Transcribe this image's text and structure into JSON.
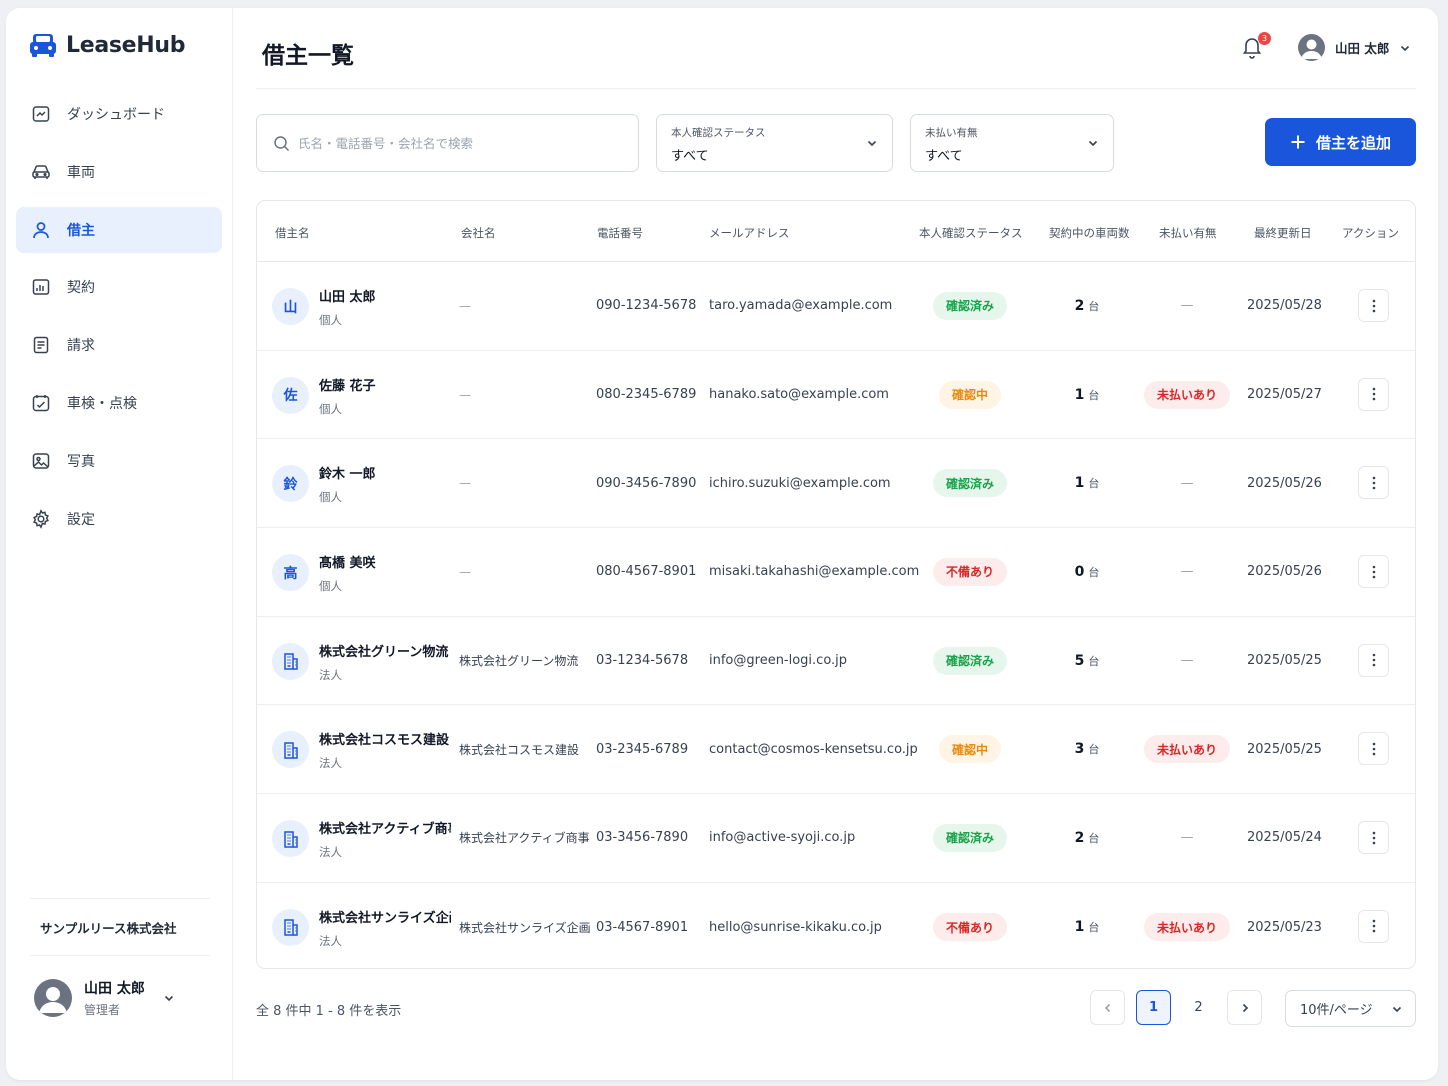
{
  "app": {
    "name": "LeaseHub"
  },
  "sidebar": {
    "items": [
      {
        "label": "ダッシュボード",
        "icon": "dashboard-icon"
      },
      {
        "label": "車両",
        "icon": "car-icon"
      },
      {
        "label": "借主",
        "icon": "user-icon",
        "active": true
      },
      {
        "label": "契約",
        "icon": "contract-icon"
      },
      {
        "label": "請求",
        "icon": "invoice-icon"
      },
      {
        "label": "車検・点検",
        "icon": "inspection-icon"
      },
      {
        "label": "写真",
        "icon": "photo-icon"
      },
      {
        "label": "設定",
        "icon": "gear-icon"
      }
    ],
    "company": "サンプルリース株式会社",
    "user": {
      "name": "山田 太郎",
      "role": "管理者"
    }
  },
  "header": {
    "title": "借主一覧",
    "notification_count": "3",
    "user_name": "山田 太郎"
  },
  "toolbar": {
    "search_placeholder": "氏名・電話番号・会社名で検索",
    "filter_status": {
      "label": "本人確認ステータス",
      "value": "すべて"
    },
    "filter_unpaid": {
      "label": "未払い有無",
      "value": "すべて"
    },
    "add_label": "借主を追加"
  },
  "table": {
    "columns": [
      "借主名",
      "会社名",
      "電話番号",
      "メールアドレス",
      "本人確認ステータス",
      "契約中の車両数",
      "未払い有無",
      "最終更新日",
      "アクション"
    ],
    "unit": "台",
    "rows": [
      {
        "avatar": "山",
        "name": "山田 太郎",
        "type": "個人",
        "company": "—",
        "phone": "090-1234-5678",
        "email": "taro.yamada@example.com",
        "status": "確認済み",
        "status_color": "green",
        "vehicles": "2",
        "unpaid": "—",
        "updated": "2025/05/28"
      },
      {
        "avatar": "佐",
        "name": "佐藤 花子",
        "type": "個人",
        "company": "—",
        "phone": "080-2345-6789",
        "email": "hanako.sato@example.com",
        "status": "確認中",
        "status_color": "orange",
        "vehicles": "1",
        "unpaid": "未払いあり",
        "updated": "2025/05/27"
      },
      {
        "avatar": "鈴",
        "name": "鈴木 一郎",
        "type": "個人",
        "company": "—",
        "phone": "090-3456-7890",
        "email": "ichiro.suzuki@example.com",
        "status": "確認済み",
        "status_color": "green",
        "vehicles": "1",
        "unpaid": "—",
        "updated": "2025/05/26"
      },
      {
        "avatar": "高",
        "name": "髙橋 美咲",
        "type": "個人",
        "company": "—",
        "phone": "080-4567-8901",
        "email": "misaki.takahashi@example.com",
        "status": "不備あり",
        "status_color": "red",
        "vehicles": "0",
        "unpaid": "—",
        "updated": "2025/05/26"
      },
      {
        "avatar": "",
        "name": "株式会社グリーン物流",
        "type": "法人",
        "company": "株式会社グリーン物流",
        "phone": "03-1234-5678",
        "email": "info@green-logi.co.jp",
        "status": "確認済み",
        "status_color": "green",
        "vehicles": "5",
        "unpaid": "—",
        "updated": "2025/05/25"
      },
      {
        "avatar": "",
        "name": "株式会社コスモス建設",
        "type": "法人",
        "company": "株式会社コスモス建設",
        "phone": "03-2345-6789",
        "email": "contact@cosmos-kensetsu.co.jp",
        "status": "確認中",
        "status_color": "orange",
        "vehicles": "3",
        "unpaid": "未払いあり",
        "updated": "2025/05/25"
      },
      {
        "avatar": "",
        "name": "株式会社アクティブ商事",
        "type": "法人",
        "company": "株式会社アクティブ商事",
        "phone": "03-3456-7890",
        "email": "info@active-syoji.co.jp",
        "status": "確認済み",
        "status_color": "green",
        "vehicles": "2",
        "unpaid": "—",
        "updated": "2025/05/24"
      },
      {
        "avatar": "",
        "name": "株式会社サンライズ企画",
        "type": "法人",
        "company": "株式会社サンライズ企画",
        "phone": "03-4567-8901",
        "email": "hello@sunrise-kikaku.co.jp",
        "status": "不備あり",
        "status_color": "red",
        "vehicles": "1",
        "unpaid": "未払いあり",
        "updated": "2025/05/23"
      }
    ]
  },
  "pagination": {
    "summary": "全 8 件中 1 - 8 件を表示",
    "pages": [
      "1",
      "2"
    ],
    "current": "1",
    "per_page": "10件/ページ"
  },
  "colors": {
    "accent": "#1a56db",
    "green": "#16a34a",
    "orange": "#ea8a0c",
    "red": "#dc2626"
  }
}
